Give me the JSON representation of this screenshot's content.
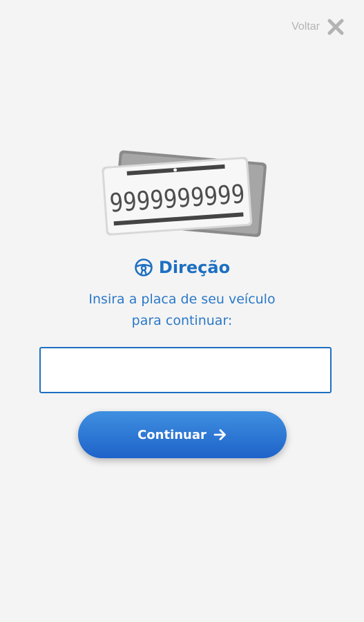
{
  "header": {
    "back_label": "Voltar",
    "close_icon": "close-x-icon"
  },
  "illustration": {
    "plate_number": "9999999999",
    "icon": "license-plate-illustration"
  },
  "section": {
    "title": "Direção",
    "icon": "steering-wheel-icon"
  },
  "instruction": {
    "line1": "Insira a placa de seu veículo",
    "line2": "para continuar:"
  },
  "form": {
    "plate_value": "",
    "plate_placeholder": "",
    "continue_label": "Continuar",
    "continue_icon": "arrow-right-icon"
  },
  "colors": {
    "primary": "#1d6fc1",
    "button_top": "#3f8fe0",
    "button_bottom": "#1e63c9",
    "background": "#f4f4f4",
    "muted": "#b3b3b3"
  }
}
